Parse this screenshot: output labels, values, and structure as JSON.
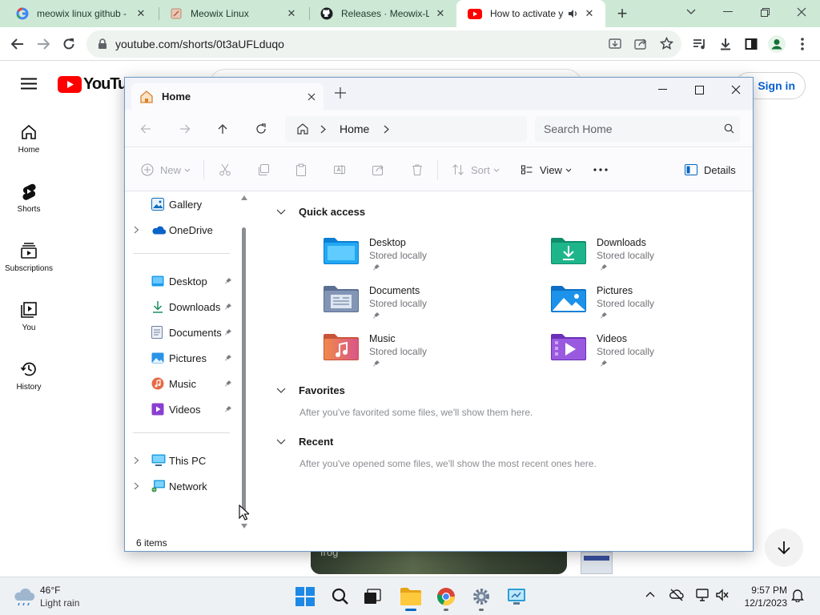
{
  "browser": {
    "tabs": [
      {
        "title": "meowix linux github -",
        "icon": "google-icon"
      },
      {
        "title": "Meowix Linux",
        "icon": "page-icon"
      },
      {
        "title": "Releases · Meowix-Lin",
        "icon": "github-icon"
      },
      {
        "title": "How to activate y",
        "icon": "youtube-icon",
        "active": true
      }
    ],
    "url": "youtube.com/shorts/0t3aUFLduqo"
  },
  "youtube": {
    "logo_text": "YouTube",
    "sign_in": "Sign in",
    "side": [
      {
        "label": "Home",
        "icon": "home-icon"
      },
      {
        "label": "Shorts",
        "icon": "shorts-icon"
      },
      {
        "label": "Subscriptions",
        "icon": "subscriptions-icon"
      },
      {
        "label": "You",
        "icon": "library-icon"
      },
      {
        "label": "History",
        "icon": "history-icon"
      }
    ],
    "video_text": "frog"
  },
  "explorer": {
    "tab_title": "Home",
    "address_crumb": "Home",
    "search_placeholder": "Search Home",
    "commands": {
      "new": "New",
      "sort": "Sort",
      "view": "View",
      "details": "Details"
    },
    "nav": {
      "gallery": "Gallery",
      "onedrive": "OneDrive",
      "pinned": [
        "Desktop",
        "Downloads",
        "Documents",
        "Pictures",
        "Music",
        "Videos"
      ],
      "thispc": "This PC",
      "network": "Network"
    },
    "sections": {
      "quick_access": "Quick access",
      "favorites": "Favorites",
      "favorites_empty": "After you've favorited some files, we'll show them here.",
      "recent": "Recent",
      "recent_empty": "After you've opened some files, we'll show the most recent ones here."
    },
    "quick_access": [
      {
        "name": "Desktop",
        "status": "Stored locally"
      },
      {
        "name": "Downloads",
        "status": "Stored locally"
      },
      {
        "name": "Documents",
        "status": "Stored locally"
      },
      {
        "name": "Pictures",
        "status": "Stored locally"
      },
      {
        "name": "Music",
        "status": "Stored locally"
      },
      {
        "name": "Videos",
        "status": "Stored locally"
      }
    ],
    "status_bar": "6 items"
  },
  "taskbar": {
    "weather_temp": "46°F",
    "weather_desc": "Light rain",
    "time": "9:57 PM",
    "date": "12/1/2023"
  },
  "colors": {
    "chrome_tabstrip": "#cde9d5",
    "youtube_red": "#ff0000",
    "explorer_accent": "#0067c0"
  }
}
